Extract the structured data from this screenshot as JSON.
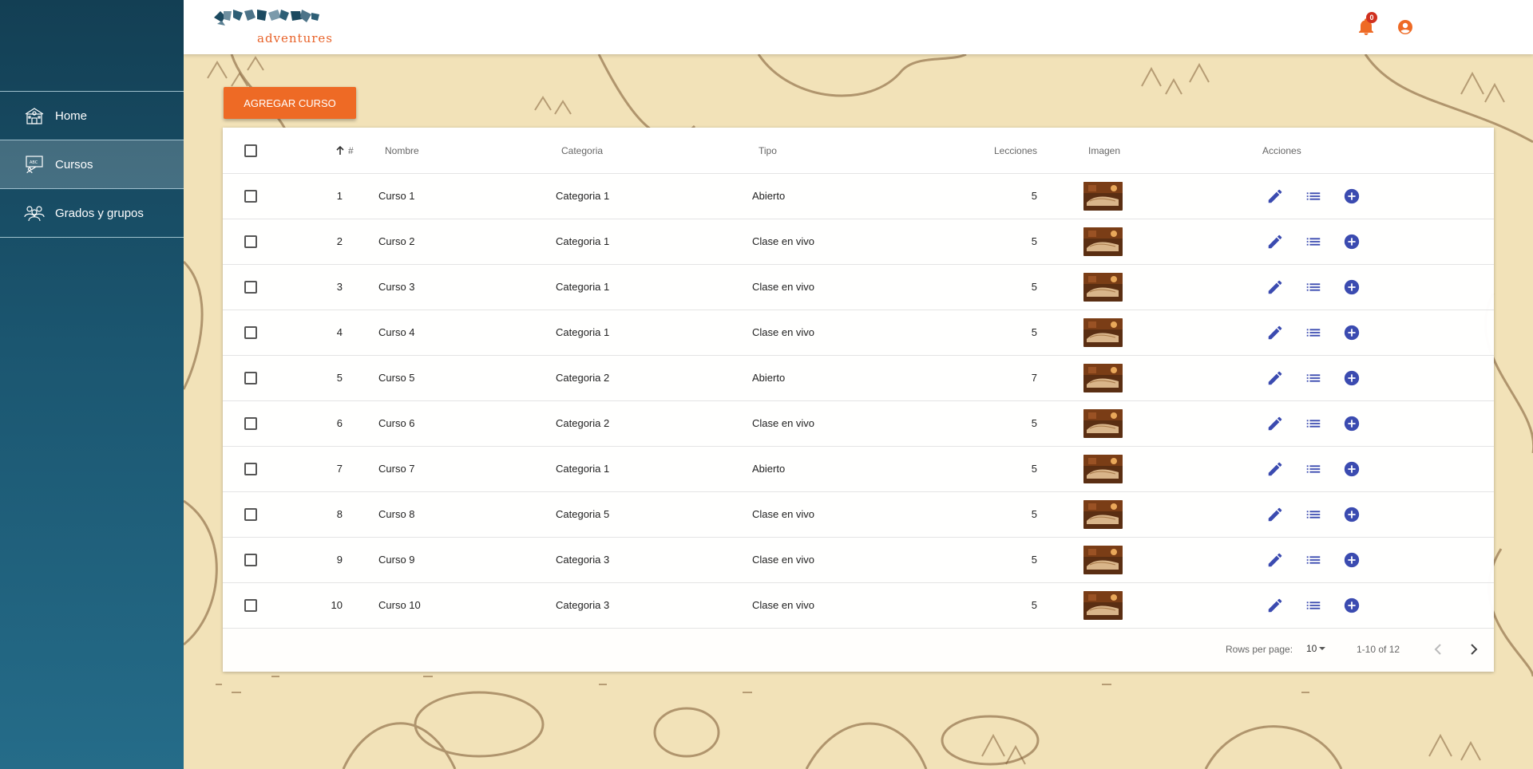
{
  "colors": {
    "accent": "#ee6a25",
    "primary_icon": "#3b4bb0",
    "sidebar_top": "#133f54",
    "sidebar_bottom": "#256c89",
    "badge": "#d0301f"
  },
  "brand": {
    "logo_text": "adventures",
    "logo_icon": "puzzle-logo-icon"
  },
  "header": {
    "notification_count": "0",
    "bell_icon": "bell-icon",
    "user_icon": "account-circle-icon"
  },
  "sidebar": {
    "items": [
      {
        "label": "Home",
        "icon": "school-building-icon",
        "active": false
      },
      {
        "label": "Cursos",
        "icon": "chalkboard-icon",
        "active": true
      },
      {
        "label": "Grados y grupos",
        "icon": "group-icon",
        "active": false
      }
    ]
  },
  "add_button": {
    "label": "AGREGAR CURSO"
  },
  "table": {
    "columns": {
      "num": "#",
      "name": "Nombre",
      "category": "Categoria",
      "type": "Tipo",
      "lessons": "Lecciones",
      "image": "Imagen",
      "actions": "Acciones"
    },
    "sort": {
      "column": "#",
      "direction": "ascending"
    },
    "rows": [
      {
        "num": "1",
        "name": "Curso 1",
        "category": "Categoria 1",
        "type": "Abierto",
        "lessons": "5"
      },
      {
        "num": "2",
        "name": "Curso 2",
        "category": "Categoria 1",
        "type": "Clase en vivo",
        "lessons": "5"
      },
      {
        "num": "3",
        "name": "Curso 3",
        "category": "Categoria 1",
        "type": "Clase en vivo",
        "lessons": "5"
      },
      {
        "num": "4",
        "name": "Curso 4",
        "category": "Categoria 1",
        "type": "Clase en vivo",
        "lessons": "5"
      },
      {
        "num": "5",
        "name": "Curso 5",
        "category": "Categoria 2",
        "type": "Abierto",
        "lessons": "7"
      },
      {
        "num": "6",
        "name": "Curso 6",
        "category": "Categoria 2",
        "type": "Clase en vivo",
        "lessons": "5"
      },
      {
        "num": "7",
        "name": "Curso 7",
        "category": "Categoria 1",
        "type": "Abierto",
        "lessons": "5"
      },
      {
        "num": "8",
        "name": "Curso 8",
        "category": "Categoria 5",
        "type": "Clase en vivo",
        "lessons": "5"
      },
      {
        "num": "9",
        "name": "Curso 9",
        "category": "Categoria 3",
        "type": "Clase en vivo",
        "lessons": "5"
      },
      {
        "num": "10",
        "name": "Curso 10",
        "category": "Categoria 3",
        "type": "Clase en vivo",
        "lessons": "5"
      }
    ],
    "row_actions": [
      "edit-icon",
      "list-icon",
      "add-circle-icon"
    ]
  },
  "pagination": {
    "rows_per_page_label": "Rows per page:",
    "rows_per_page": "10",
    "range": "1-10 of 12"
  }
}
